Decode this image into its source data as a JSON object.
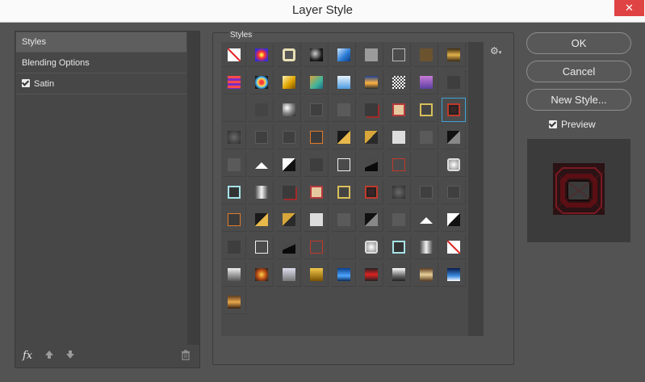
{
  "window": {
    "title": "Layer Style",
    "close_glyph": "✕"
  },
  "left_panel": {
    "items": [
      {
        "label": "Styles",
        "checkbox": false
      },
      {
        "label": "Blending Options",
        "checkbox": false
      },
      {
        "label": "Satin",
        "checkbox": true
      }
    ],
    "footer_icons": [
      "fx-icon",
      "arrow-up-icon",
      "arrow-down-icon",
      "trash-icon"
    ],
    "fx_label": "fx"
  },
  "styles_panel": {
    "title": "Styles",
    "gear_glyph": "⚙",
    "selected_index": 26,
    "swatches": [
      "none",
      "violet-glow",
      "ring-beige",
      "chrome-black",
      "blue-glass",
      "gray-plain",
      "frame-icon",
      "brown-plain",
      "gold-bar",
      "red-purple-stripes",
      "colorful-splash",
      "gold-glass",
      "teal-gold",
      "blue-sky",
      "blue-sunset",
      "white-noise",
      "purple-gradient",
      "dark-gray",
      "empty",
      "gray-dark",
      "silver-sphere",
      "gray-button",
      "gray-soft",
      "red-shadow",
      "beige-glitter",
      "gold-ring",
      "red-outline-ring",
      "gray-embossed",
      "gray-button",
      "gray-button",
      "orange-outline",
      "gold-triangle",
      "gold-triangle-light",
      "white-square",
      "gray-soft",
      "black-triangle",
      "gray-soft",
      "white-arrow",
      "black-white-diag",
      "dark-gray",
      "white-outline",
      "black-diag",
      "red-outline",
      "empty",
      "silver-box",
      "teal-outline",
      "silver-gradient",
      "red-shadow",
      "beige-glitter",
      "gold-ring",
      "red-outline-ring",
      "gray-embossed",
      "gray-button",
      "gray-button",
      "orange-outline",
      "gold-triangle",
      "gold-triangle-light",
      "white-square",
      "gray-soft",
      "black-triangle",
      "gray-soft",
      "white-arrow",
      "black-white-diag",
      "dark-gray",
      "white-outline",
      "black-diag",
      "red-outline",
      "empty",
      "silver-box",
      "teal-outline",
      "silver-gradient",
      "none",
      "photo-silver",
      "photo-fire",
      "photo-sky",
      "photo-gold",
      "photo-blue",
      "photo-red",
      "photo-metal",
      "photo-bronze",
      "photo-night",
      "photo-sunset"
    ]
  },
  "buttons": {
    "ok": "OK",
    "cancel": "Cancel",
    "new_style": "New Style..."
  },
  "preview": {
    "label": "Preview",
    "checked": true
  },
  "colors": {
    "accent": "#3da2d8",
    "background": "#535353"
  }
}
